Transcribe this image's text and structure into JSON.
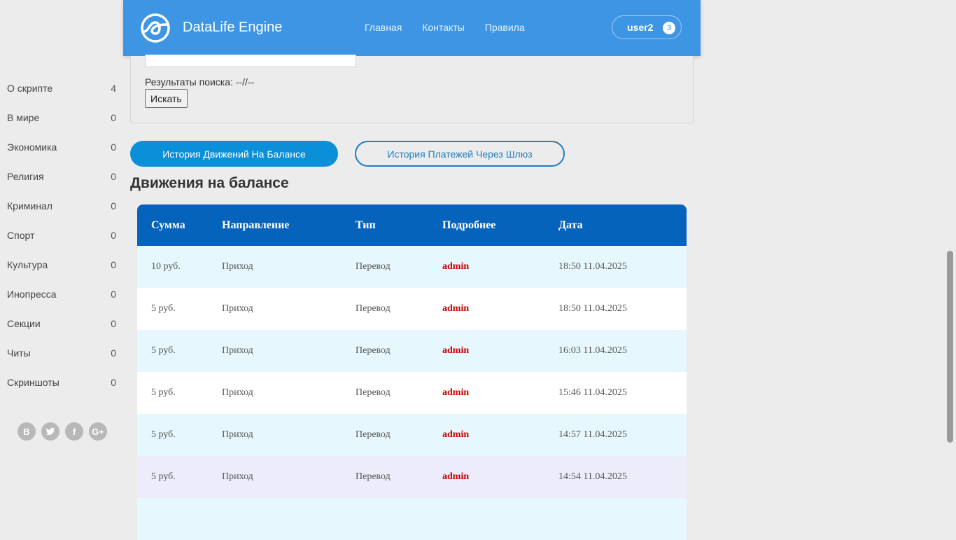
{
  "header": {
    "site_name": "DataLife Engine",
    "nav": [
      "Главная",
      "Контакты",
      "Правила"
    ],
    "user": "user2",
    "badge_count": "3",
    "brand_color": "#3d95e4"
  },
  "sidebar": {
    "categories": [
      {
        "label": "О скрипте",
        "count": "4"
      },
      {
        "label": "В мире",
        "count": "0"
      },
      {
        "label": "Экономика",
        "count": "0"
      },
      {
        "label": "Религия",
        "count": "0"
      },
      {
        "label": "Криминал",
        "count": "0"
      },
      {
        "label": "Спорт",
        "count": "0"
      },
      {
        "label": "Культура",
        "count": "0"
      },
      {
        "label": "Инопресса",
        "count": "0"
      },
      {
        "label": "Секции",
        "count": "0"
      },
      {
        "label": "Читы",
        "count": "0"
      },
      {
        "label": "Скриншоты",
        "count": "0"
      }
    ],
    "social": [
      {
        "icon": "vk-icon",
        "glyph": "B"
      },
      {
        "icon": "twitter-icon",
        "glyph": ""
      },
      {
        "icon": "facebook-icon",
        "glyph": "f"
      },
      {
        "icon": "google-plus-icon",
        "glyph": "G+"
      }
    ]
  },
  "search": {
    "results_text": "Результаты поиска: --//--",
    "button_label": "Искать"
  },
  "tabs": {
    "active": "История Движений На Балансе",
    "inactive": "История Платежей Через Шлюз"
  },
  "section_title": "Движения на балансе",
  "table": {
    "headers": [
      "Сумма",
      "Направление",
      "Тип",
      "Подробнее",
      "Дата"
    ],
    "rows": [
      [
        "10 руб.",
        "Приход",
        "Перевод",
        "admin",
        "18:50 11.04.2025"
      ],
      [
        "5 руб.",
        "Приход",
        "Перевод",
        "admin",
        "18:50 11.04.2025"
      ],
      [
        "5 руб.",
        "Приход",
        "Перевод",
        "admin",
        "16:03 11.04.2025"
      ],
      [
        "5 руб.",
        "Приход",
        "Перевод",
        "admin",
        "15:46 11.04.2025"
      ],
      [
        "5 руб.",
        "Приход",
        "Перевод",
        "admin",
        "14:57 11.04.2025"
      ],
      [
        "5 руб.",
        "Приход",
        "Перевод",
        "admin",
        "14:54 11.04.2025"
      ]
    ]
  }
}
